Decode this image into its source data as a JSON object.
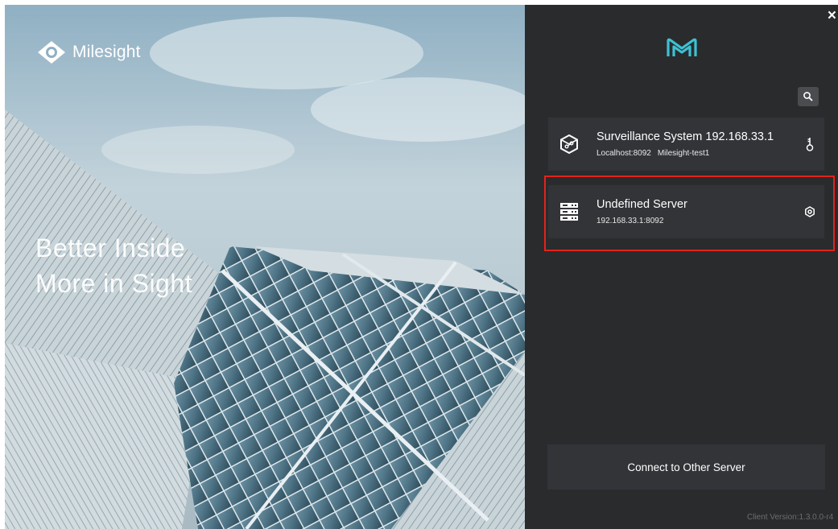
{
  "hero": {
    "logo_text": "Milesight",
    "slogan_line1": "Better Inside",
    "slogan_line2": "More in Sight"
  },
  "panel": {
    "close_label": "×",
    "servers": [
      {
        "title": "Surveillance System 192.168.33.1",
        "host": "Localhost:8092",
        "name": "Milesight-test1",
        "icon": "cube-network-icon",
        "action_icon": "key-icon"
      },
      {
        "title": "Undefined Server",
        "host": "192.168.33.1:8092",
        "icon": "server-rack-icon",
        "action_icon": "settings-icon"
      }
    ],
    "connect_label": "Connect to Other Server",
    "version_text": "Client Version:1.3.0.0-r4"
  },
  "colors": {
    "panel_bg": "#2a2b2d",
    "card_bg": "#333438",
    "highlight": "#e2231a",
    "brand": "#3ec1d3"
  }
}
